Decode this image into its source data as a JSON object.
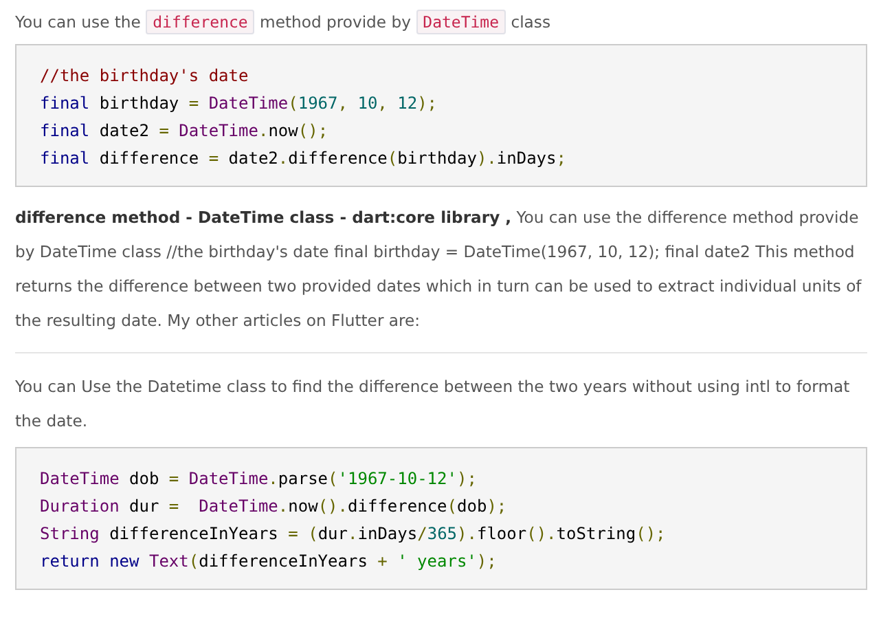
{
  "intro": [
    {
      "kind": "text",
      "text": "You can use the "
    },
    {
      "kind": "code",
      "text": "difference"
    },
    {
      "kind": "text",
      "text": " method provide by "
    },
    {
      "kind": "code",
      "text": "DateTime"
    },
    {
      "kind": "text",
      "text": " class"
    }
  ],
  "code_block_1": [
    [
      {
        "kind": "comment",
        "text": "//the birthday's date"
      }
    ],
    [
      {
        "kind": "keyword",
        "text": "final"
      },
      {
        "kind": "plain",
        "text": " birthday "
      },
      {
        "kind": "punct",
        "text": "= "
      },
      {
        "kind": "type",
        "text": "DateTime"
      },
      {
        "kind": "punct",
        "text": "("
      },
      {
        "kind": "number",
        "text": "1967"
      },
      {
        "kind": "punct",
        "text": ", "
      },
      {
        "kind": "number",
        "text": "10"
      },
      {
        "kind": "punct",
        "text": ", "
      },
      {
        "kind": "number",
        "text": "12"
      },
      {
        "kind": "punct",
        "text": ");"
      }
    ],
    [
      {
        "kind": "keyword",
        "text": "final"
      },
      {
        "kind": "plain",
        "text": " date2 "
      },
      {
        "kind": "punct",
        "text": "= "
      },
      {
        "kind": "type",
        "text": "DateTime"
      },
      {
        "kind": "punct",
        "text": "."
      },
      {
        "kind": "plain",
        "text": "now"
      },
      {
        "kind": "punct",
        "text": "();"
      }
    ],
    [
      {
        "kind": "keyword",
        "text": "final"
      },
      {
        "kind": "plain",
        "text": " difference "
      },
      {
        "kind": "punct",
        "text": "="
      },
      {
        "kind": "plain",
        "text": " date2"
      },
      {
        "kind": "punct",
        "text": "."
      },
      {
        "kind": "plain",
        "text": "difference"
      },
      {
        "kind": "punct",
        "text": "("
      },
      {
        "kind": "plain",
        "text": "birthday"
      },
      {
        "kind": "punct",
        "text": ")."
      },
      {
        "kind": "plain",
        "text": "inDays"
      },
      {
        "kind": "punct",
        "text": ";"
      }
    ]
  ],
  "snippet_paragraph": "**difference method - DateTime class - dart:core library ,** You can use the difference method provide by DateTime class //the birthday's date final birthday = DateTime(1967, 10, 12); final date2  This method returns the difference between two provided dates which in turn can be used to extract individual units of the resulting date. My other articles on Flutter are:",
  "answer_paragraph": "You can Use the Datetime class to find the difference between the two years without using intl to format the date.",
  "code_block_2": [
    [
      {
        "kind": "type",
        "text": "DateTime"
      },
      {
        "kind": "plain",
        "text": " dob "
      },
      {
        "kind": "punct",
        "text": "= "
      },
      {
        "kind": "type",
        "text": "DateTime"
      },
      {
        "kind": "punct",
        "text": "."
      },
      {
        "kind": "plain",
        "text": "parse"
      },
      {
        "kind": "punct",
        "text": "("
      },
      {
        "kind": "string",
        "text": "'1967-10-12'"
      },
      {
        "kind": "punct",
        "text": ");"
      }
    ],
    [
      {
        "kind": "type",
        "text": "Duration"
      },
      {
        "kind": "plain",
        "text": " dur "
      },
      {
        "kind": "punct",
        "text": "=  "
      },
      {
        "kind": "type",
        "text": "DateTime"
      },
      {
        "kind": "punct",
        "text": "."
      },
      {
        "kind": "plain",
        "text": "now"
      },
      {
        "kind": "punct",
        "text": "()."
      },
      {
        "kind": "plain",
        "text": "difference"
      },
      {
        "kind": "punct",
        "text": "("
      },
      {
        "kind": "plain",
        "text": "dob"
      },
      {
        "kind": "punct",
        "text": ");"
      }
    ],
    [
      {
        "kind": "type",
        "text": "String"
      },
      {
        "kind": "plain",
        "text": " differenceInYears "
      },
      {
        "kind": "punct",
        "text": "= ("
      },
      {
        "kind": "plain",
        "text": "dur"
      },
      {
        "kind": "punct",
        "text": "."
      },
      {
        "kind": "plain",
        "text": "inDays"
      },
      {
        "kind": "punct",
        "text": "/"
      },
      {
        "kind": "number",
        "text": "365"
      },
      {
        "kind": "punct",
        "text": ")."
      },
      {
        "kind": "plain",
        "text": "floor"
      },
      {
        "kind": "punct",
        "text": "()."
      },
      {
        "kind": "plain",
        "text": "toString"
      },
      {
        "kind": "punct",
        "text": "();"
      }
    ],
    [
      {
        "kind": "keyword",
        "text": "return new"
      },
      {
        "kind": "type",
        "text": " Text"
      },
      {
        "kind": "punct",
        "text": "("
      },
      {
        "kind": "plain",
        "text": "differenceInYears "
      },
      {
        "kind": "punct",
        "text": "+ "
      },
      {
        "kind": "string",
        "text": "' years'"
      },
      {
        "kind": "punct",
        "text": ");"
      }
    ]
  ]
}
